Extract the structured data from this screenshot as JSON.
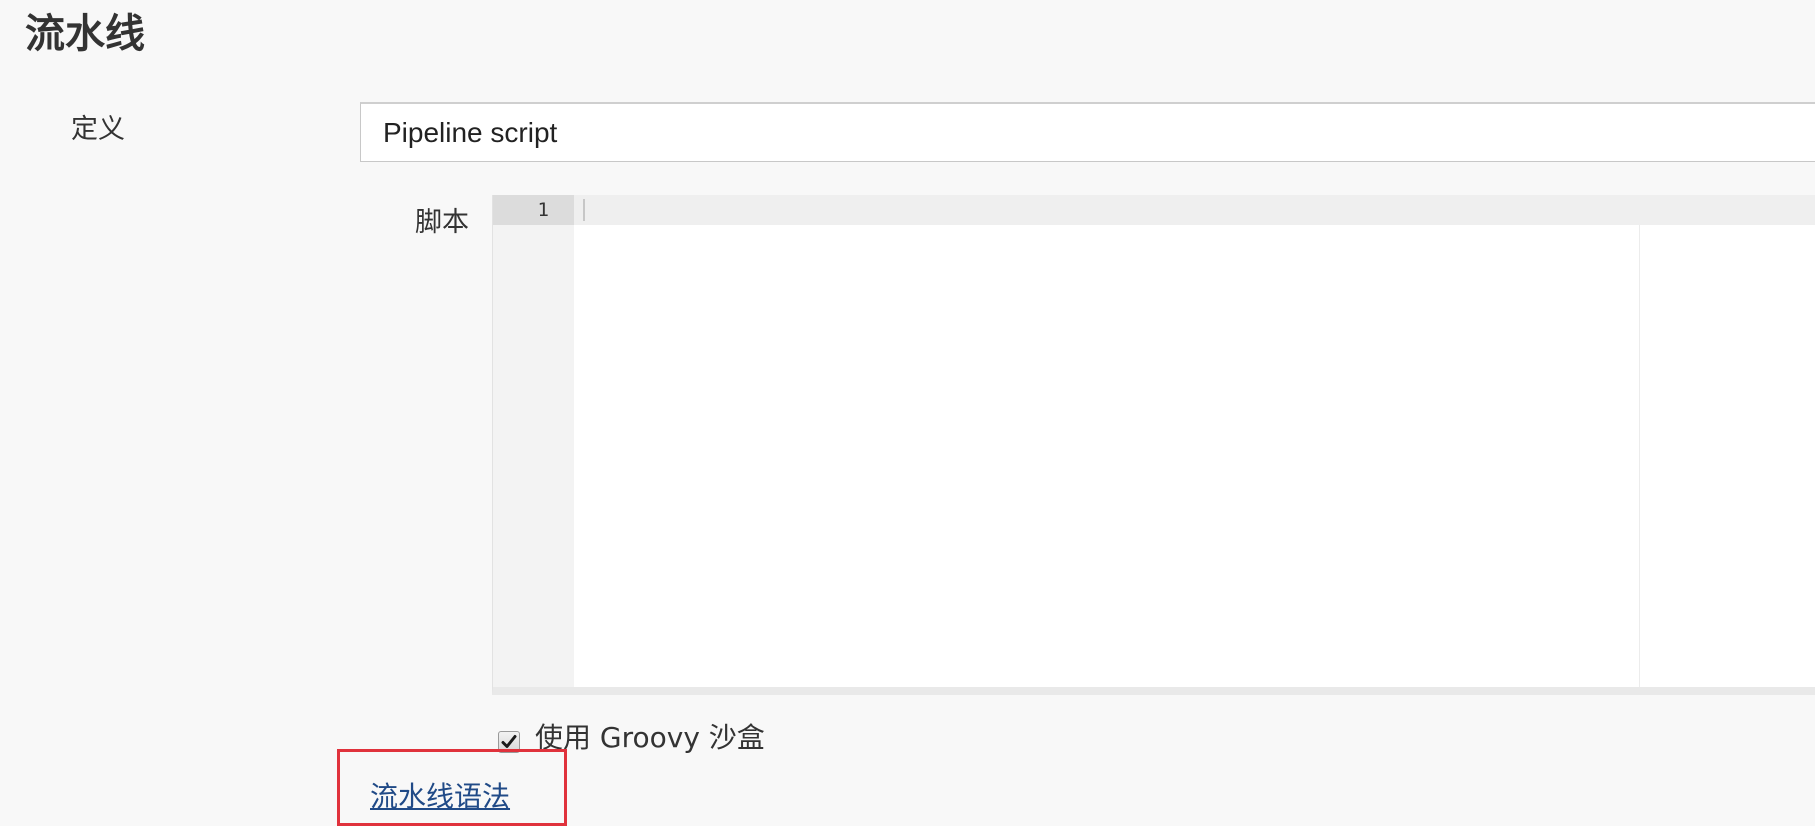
{
  "section": {
    "title": "流水线"
  },
  "definition": {
    "label": "定义",
    "selected_value": "Pipeline script"
  },
  "script": {
    "label": "脚本",
    "line_numbers": [
      "1"
    ],
    "content": ""
  },
  "groovy_sandbox": {
    "label": "使用 Groovy 沙盒",
    "checked": true,
    "check_icon": "check-icon"
  },
  "pipeline_syntax": {
    "link_text": "流水线语法"
  },
  "colors": {
    "background": "#f8f8f8",
    "link": "#204a87",
    "highlight_border": "#e0323c",
    "editor_gutter": "#f3f3f3"
  }
}
